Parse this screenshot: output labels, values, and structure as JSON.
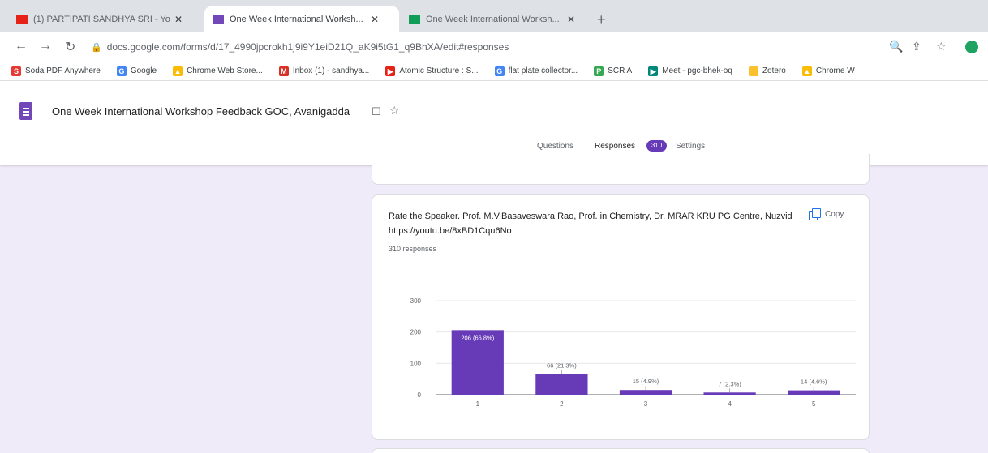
{
  "browser": {
    "tabs": [
      {
        "title": "(1) PARTIPATI SANDHYA SRI - Yo...",
        "favicon_color": "#e62117",
        "active": false
      },
      {
        "title": "One Week International Worksh...",
        "favicon_color": "#7248b9",
        "active": true
      },
      {
        "title": "One Week International Worksh...",
        "favicon_color": "#0f9d58",
        "active": false
      }
    ],
    "new_tab": "+",
    "url": "docs.google.com/forms/d/17_4990jpcrokh1j9i9Y1eiD21Q_aK9i5tG1_q9BhXA/edit#responses",
    "bookmarks": [
      {
        "label": "Soda PDF Anywhere",
        "icon": "S",
        "color": "#e53935"
      },
      {
        "label": "Google",
        "icon": "G",
        "color": "#4285f4"
      },
      {
        "label": "Chrome Web Store...",
        "icon": "▲",
        "color": "#fbbc05"
      },
      {
        "label": "Inbox (1) - sandhya...",
        "icon": "M",
        "color": "#d93025"
      },
      {
        "label": "Atomic Structure : S...",
        "icon": "▶",
        "color": "#e62117"
      },
      {
        "label": "flat plate collector...",
        "icon": "G",
        "color": "#4285f4"
      },
      {
        "label": "SCR A",
        "icon": "P",
        "color": "#34a853"
      },
      {
        "label": "Meet - pgc-bhek-oq",
        "icon": "▶",
        "color": "#00897b"
      },
      {
        "label": "Zotero",
        "icon": "",
        "color": "#fbc02d"
      },
      {
        "label": "Chrome W",
        "icon": "▲",
        "color": "#fbbc05"
      }
    ]
  },
  "form": {
    "title": "One Week International Workshop Feedback GOC, Avanigadda",
    "tabs": {
      "questions": "Questions",
      "responses": "Responses",
      "settings": "Settings"
    },
    "response_badge": "310"
  },
  "question": {
    "text": "Rate the Speaker. Prof. M.V.Basaveswara Rao, Prof. in Chemistry, Dr. MRAR KRU PG Centre, Nuzvid https://youtu.be/8xBD1Cqu6No",
    "copy_label": "Copy",
    "responses_label": "310 responses"
  },
  "chart_data": {
    "type": "bar",
    "categories": [
      "1",
      "2",
      "3",
      "4",
      "5"
    ],
    "values": [
      206,
      66,
      15,
      7,
      14
    ],
    "data_labels": [
      "206 (66.8%)",
      "66 (21.3%)",
      "15 (4.9%)",
      "7 (2.3%)",
      "14 (4.6%)"
    ],
    "y_ticks": [
      0,
      100,
      200,
      300
    ],
    "ylim": [
      0,
      300
    ],
    "color": "#673ab7",
    "grid": true
  }
}
